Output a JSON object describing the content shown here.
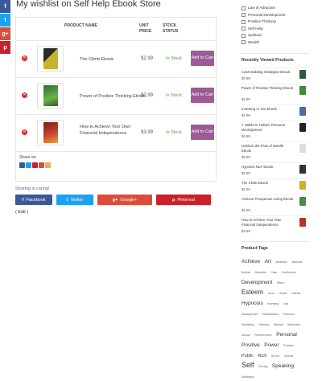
{
  "social_sidebar": {
    "facebook": {
      "glyph": "f",
      "color": "#3b5998"
    },
    "twitter": {
      "glyph": "t",
      "color": "#1da1f2"
    },
    "googleplus": {
      "glyph": "g+",
      "color": "#dd4b39"
    },
    "pinterest": {
      "glyph": "p",
      "color": "#cb2027"
    }
  },
  "page_title": "My wishlist on Self Help Ebook Store",
  "table": {
    "headers": {
      "product_name": "PRODUCT NAME",
      "unit_price": "UNIT PRICE",
      "stock_status": "STOCK STATUS"
    },
    "rows": [
      {
        "name": "The Climb Ebook",
        "price": "$2.99",
        "stock": "In Stock",
        "button": "Add to Cart",
        "cover_color": "#c9b32a",
        "icon": "climb-book-icon"
      },
      {
        "name": "Power of Positive Thinking Ebook",
        "price": "$2.99",
        "stock": "In Stock",
        "button": "Add to Cart",
        "cover_color": "#3c8a3a",
        "icon": "positive-thinking-book-icon"
      },
      {
        "name": "How to Achieve Your Own Financial Independence",
        "price": "$3.99",
        "stock": "In Stock",
        "button": "Add to Cart",
        "cover_color": "#b5342a",
        "icon": "financial-book-icon"
      }
    ],
    "share_label": "Share on:"
  },
  "share_section": {
    "label": "Sharing is caring!",
    "buttons": {
      "facebook": "Facebook",
      "twitter": "Twitter",
      "googleplus": "Google+",
      "pinterest": "Pinterest"
    },
    "colors": {
      "facebook": "#3b5998",
      "twitter": "#1da1f2",
      "googleplus": "#dd4b39",
      "pinterest": "#cb2027"
    },
    "edit": "( Edit )"
  },
  "sidebar": {
    "categories": [
      "Law of Attraction",
      "Personal Development",
      "Positive Thinking",
      "Self Help",
      "Spiritual",
      "Wealth"
    ],
    "recent_heading": "Recently Viewed Products",
    "recent": [
      {
        "name": "Cash Building Strategies Ebook",
        "price": "$3.99"
      },
      {
        "name": "Power of Positive Thinking Ebook",
        "price": "$2.99"
      },
      {
        "name": "Investing In You Ebook",
        "price": "$4.99"
      },
      {
        "name": "7 Habits In Holistic Personal Development",
        "price": "$4.99"
      },
      {
        "name": "Unblock the Flow of Wealth Ebook",
        "price": "$3.99"
      },
      {
        "name": "Hypnotic NLP Ebook",
        "price": "$3.99"
      },
      {
        "name": "The Climb Ebook",
        "price": "$2.99"
      },
      {
        "name": "Achieve Prosperous Living Ebook",
        "price": "$4.99"
      },
      {
        "name": "How to Achieve Your Own Financial Independence",
        "price": "$3.99"
      }
    ],
    "tags_heading": "Product Tags",
    "tags": [
      {
        "t": "Achieve",
        "s": 6.5
      },
      {
        "t": "Art",
        "s": 6.5
      },
      {
        "t": "Attraction",
        "s": 3.5
      },
      {
        "t": "Baroque",
        "s": 3.5
      },
      {
        "t": "Believe",
        "s": 3.5
      },
      {
        "t": "Boosters",
        "s": 3.5
      },
      {
        "t": "Cash",
        "s": 3.5
      },
      {
        "t": "Confidence",
        "s": 3.5
      },
      {
        "t": "Development",
        "s": 6.5
      },
      {
        "t": "Effect",
        "s": 3.5
      },
      {
        "t": "Esteem",
        "s": 8
      },
      {
        "t": "Good",
        "s": 3.5
      },
      {
        "t": "Health",
        "s": 3.5
      },
      {
        "t": "Holistic",
        "s": 3.5
      },
      {
        "t": "Hypnosis",
        "s": 6.5
      },
      {
        "t": "Investing",
        "s": 3.5
      },
      {
        "t": "Law",
        "s": 3.5
      },
      {
        "t": "Management",
        "s": 3.5
      },
      {
        "t": "Manifestation",
        "s": 3.5
      },
      {
        "t": "Manners",
        "s": 3.5
      },
      {
        "t": "Meditation",
        "s": 3.5
      },
      {
        "t": "Memory",
        "s": 3.5
      },
      {
        "t": "Mindset",
        "s": 3.5
      },
      {
        "t": "Motivation",
        "s": 3.5
      },
      {
        "t": "Mozart",
        "s": 3.5
      },
      {
        "t": "Perseverance",
        "s": 3.5
      },
      {
        "t": "Personal",
        "s": 6.5
      },
      {
        "t": "Positive",
        "s": 6.5
      },
      {
        "t": "Power",
        "s": 6.5
      },
      {
        "t": "Problem",
        "s": 3.5
      },
      {
        "t": "Public",
        "s": 5.5
      },
      {
        "t": "Rich",
        "s": 5.5
      },
      {
        "t": "Secret",
        "s": 3.5
      },
      {
        "t": "Secrets",
        "s": 3.5
      },
      {
        "t": "Self",
        "s": 9
      },
      {
        "t": "Solving",
        "s": 3.5
      },
      {
        "t": "Speaking",
        "s": 6.5
      },
      {
        "t": "Strategies",
        "s": 3.5
      }
    ]
  }
}
